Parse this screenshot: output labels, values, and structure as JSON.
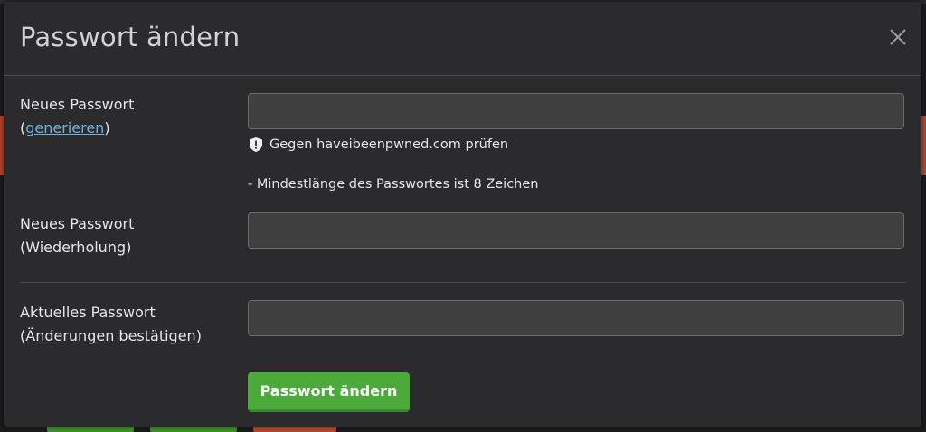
{
  "modal": {
    "title": "Passwort ändern",
    "close_icon": "close-icon"
  },
  "form": {
    "new_password": {
      "label_line1": "Neues Passwort",
      "label_prefix": "(",
      "generate_link": "generieren",
      "label_suffix": ")",
      "value": ""
    },
    "hibp_check": {
      "icon": "shield-icon",
      "text": "Gegen haveibeenpwned.com prüfen"
    },
    "min_length_hint": "- Mindestlänge des Passwortes ist 8 Zeichen",
    "repeat_password": {
      "label_line1": "Neues Passwort",
      "label_line2": "(Wiederholung)",
      "value": ""
    },
    "current_password": {
      "label_line1": "Aktuelles Passwort",
      "label_line2": "(Änderungen bestätigen)",
      "value": ""
    },
    "submit_label": "Passwort ändern"
  },
  "colors": {
    "modal_bg": "#2b2b2d",
    "input_bg": "#404040",
    "link": "#6fb3e0",
    "submit": "#4caa3a"
  }
}
